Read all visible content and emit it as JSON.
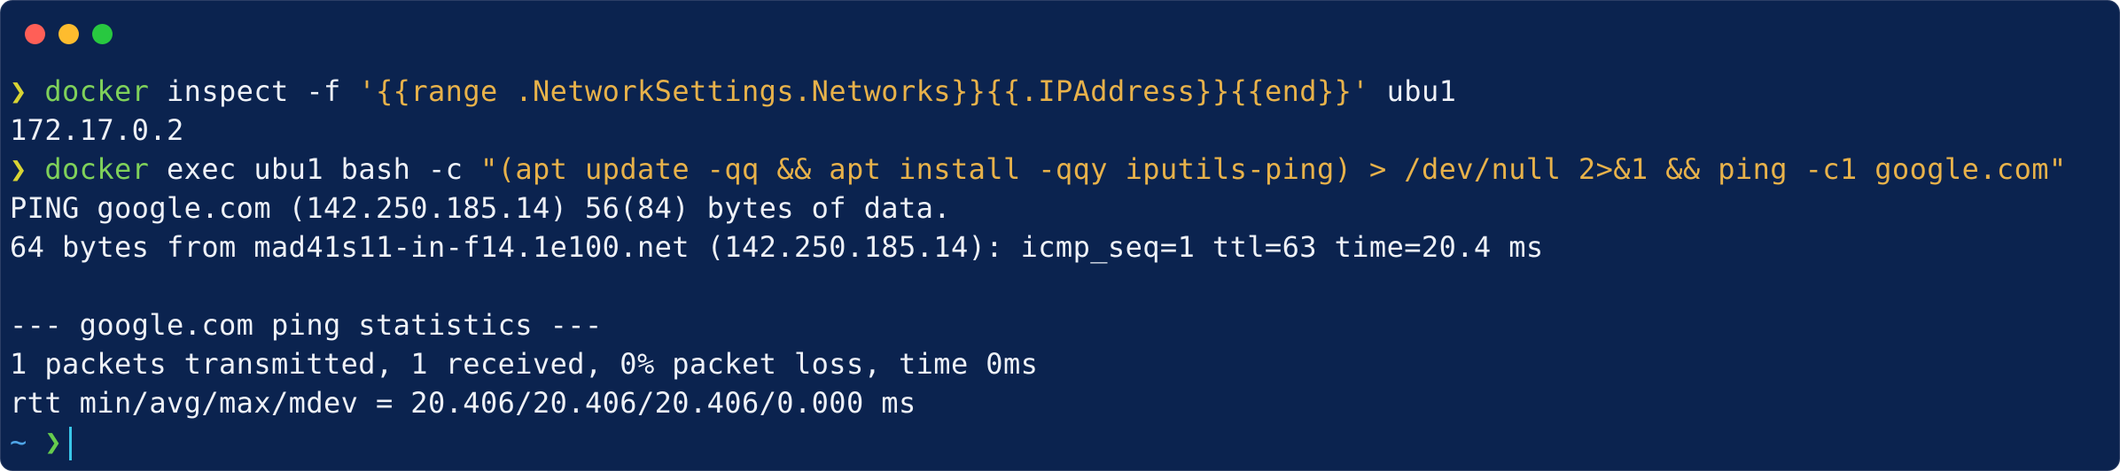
{
  "window": {
    "controls": [
      "close",
      "minimize",
      "maximize"
    ]
  },
  "terminal": {
    "prompt_symbol": "❯",
    "home_symbol": "~",
    "lines": [
      {
        "type": "command",
        "program": "docker",
        "args_plain": " inspect -f ",
        "string_arg": "'{{range .NetworkSettings.Networks}}{{.IPAddress}}{{end}}'",
        "args_tail": " ubu1"
      },
      {
        "type": "output",
        "text": "172.17.0.2"
      },
      {
        "type": "command",
        "program": "docker",
        "args_plain": " exec ubu1 bash -c ",
        "string_arg": "\"(apt update -qq && apt install -qqy iputils-ping) > /dev/null 2>&1 && ping -c1 google.com\"",
        "args_tail": ""
      },
      {
        "type": "output",
        "text": "PING google.com (142.250.185.14) 56(84) bytes of data."
      },
      {
        "type": "output",
        "text": "64 bytes from mad41s11-in-f14.1e100.net (142.250.185.14): icmp_seq=1 ttl=63 time=20.4 ms"
      },
      {
        "type": "output",
        "text": ""
      },
      {
        "type": "output",
        "text": "--- google.com ping statistics ---"
      },
      {
        "type": "output",
        "text": "1 packets transmitted, 1 received, 0% packet loss, time 0ms"
      },
      {
        "type": "output",
        "text": "rtt min/avg/max/mdev = 20.406/20.406/20.406/0.000 ms"
      }
    ]
  },
  "colors": {
    "background": "#0b234f",
    "text": "#eef1f7",
    "command": "#7fd15a",
    "string": "#e8b24a",
    "prompt_chevron": "#d8d434",
    "tilde": "#4fa6e8",
    "cursor": "#39c6e8"
  }
}
